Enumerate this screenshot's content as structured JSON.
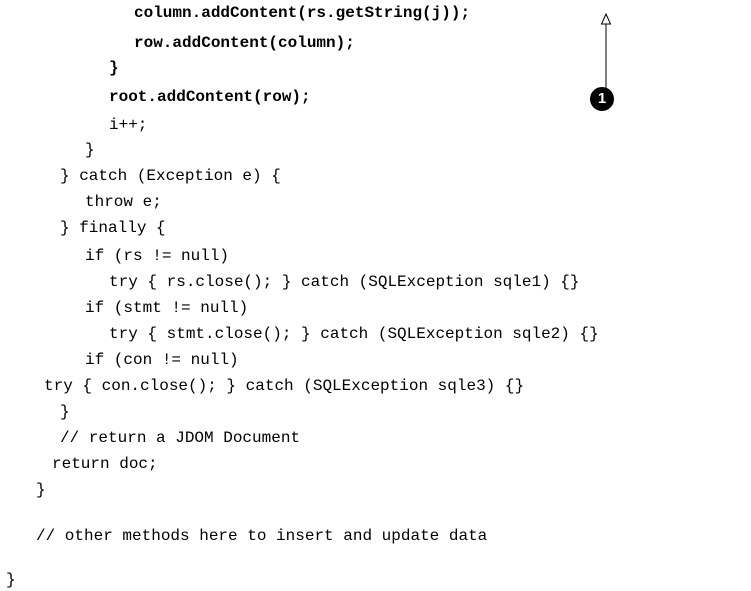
{
  "code": {
    "lines": [
      "column.addContent(rs.getString(j));",
      "row.addContent(column);",
      "}",
      "root.addContent(row);",
      "i++;",
      "}",
      "} catch (Exception e) {",
      "throw e;",
      "} finally {",
      "if (rs != null)",
      "try { rs.close(); } catch (SQLException sqle1) {}",
      "if (stmt != null)",
      "try { stmt.close(); } catch (SQLException sqle2) {}",
      "if (con != null)",
      "try { con.close(); } catch (SQLException sqle3) {}",
      "}",
      "// return a JDOM Document",
      "return doc;",
      "}",
      "// other methods here to insert and update data",
      "}"
    ]
  },
  "callout": {
    "number": "1"
  },
  "colors": {
    "text": "#000000",
    "background": "#ffffff",
    "callout_fill": "#000000"
  }
}
